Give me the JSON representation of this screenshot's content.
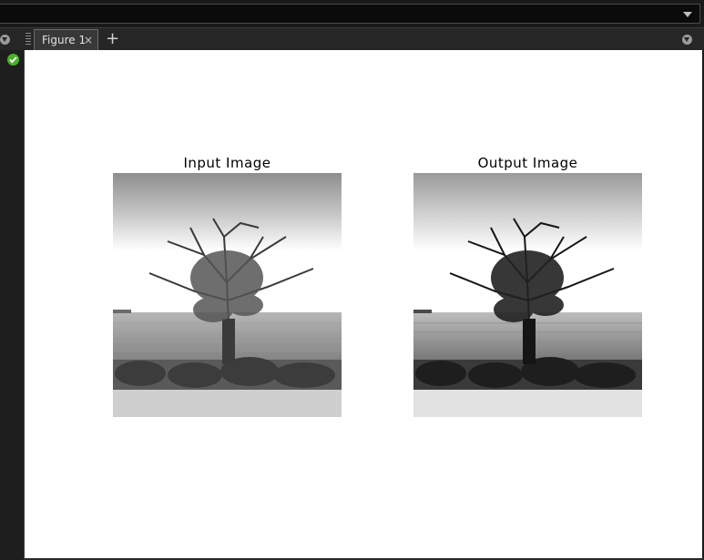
{
  "toolbar": {
    "dropdown_icon": "chevron-down-icon"
  },
  "tabs": [
    {
      "label": "Figure 1",
      "close": "×"
    }
  ],
  "add_tab_label": "+",
  "status": {
    "icon": "check-circle-icon",
    "color": "#4caf2a"
  },
  "figure": {
    "left_title": "Input Image",
    "right_title": "Output Image"
  }
}
